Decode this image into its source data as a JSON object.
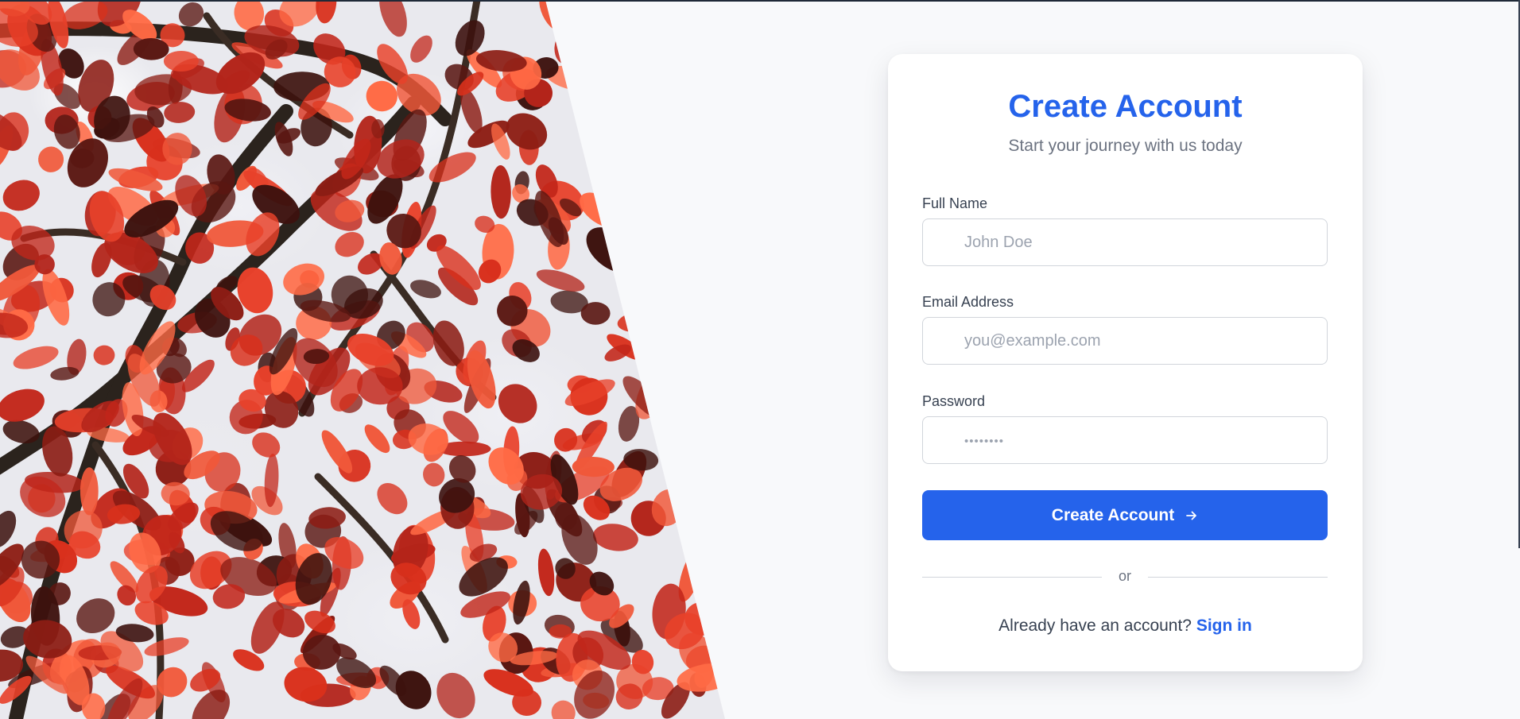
{
  "form": {
    "title": "Create Account",
    "subtitle": "Start your journey with us today",
    "fields": [
      {
        "label": "Full Name",
        "placeholder": "John Doe",
        "value": ""
      },
      {
        "label": "Email Address",
        "placeholder": "you@example.com",
        "value": ""
      },
      {
        "label": "Password",
        "placeholder": "••••••••",
        "value": ""
      }
    ],
    "submit_label": "Create Account",
    "divider_text": "or",
    "signin_prompt": "Already have an account?",
    "signin_link": "Sign in"
  },
  "hero": {
    "subject": "red autumn leaves on tree branches"
  },
  "colors": {
    "accent": "#2563eb",
    "background": "#f8f9fb",
    "card": "#ffffff",
    "muted_text": "#6b7280",
    "leaf_red": "#d9301c",
    "leaf_dark": "#4a1410"
  }
}
